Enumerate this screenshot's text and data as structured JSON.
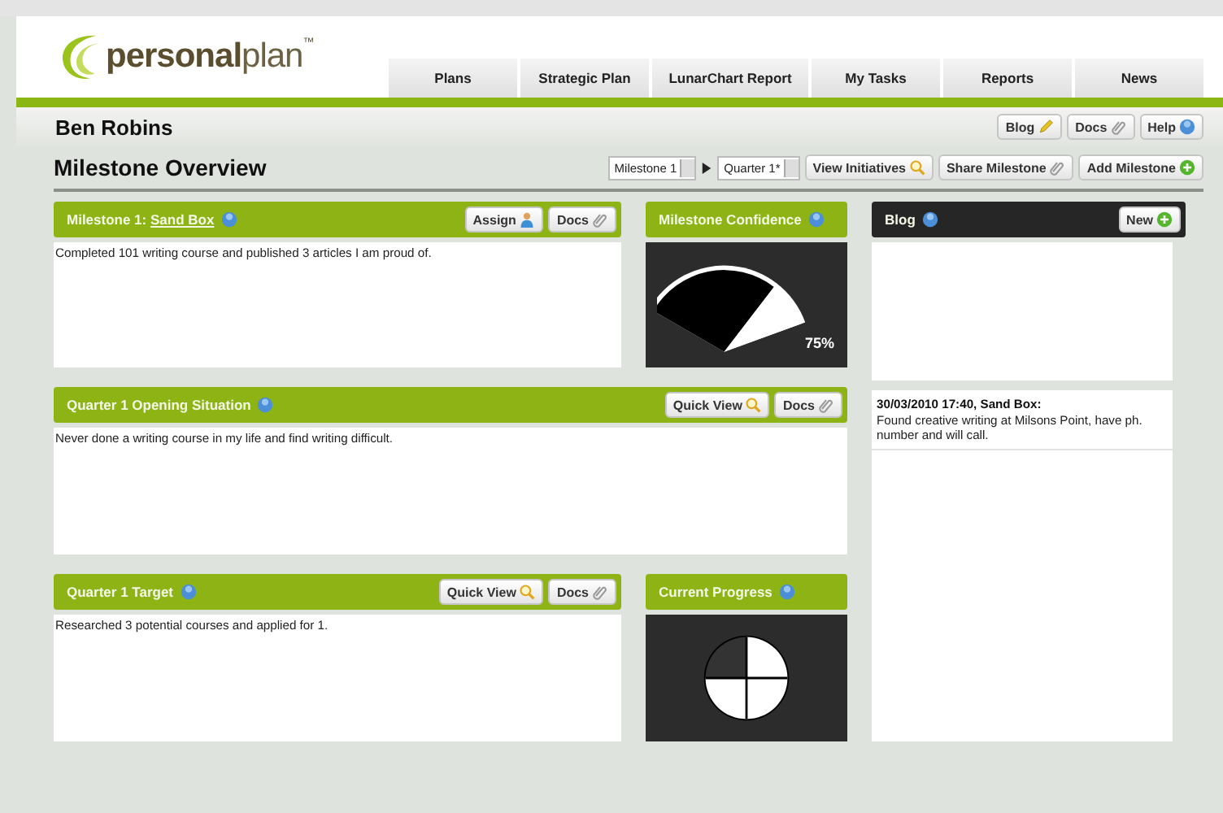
{
  "logo": {
    "bold": "personal",
    "light": "plan",
    "mark": "™"
  },
  "nav_tabs": [
    {
      "label": "Plans"
    },
    {
      "label": "Strategic Plan"
    },
    {
      "label": "LunarChart Report"
    },
    {
      "label": "My Tasks"
    },
    {
      "label": "Reports"
    },
    {
      "label": "News"
    }
  ],
  "user_name": "Ben Robins",
  "header_buttons": [
    {
      "label": "Blog",
      "kind": "pencil"
    },
    {
      "label": "Docs",
      "kind": "clip"
    },
    {
      "label": "Help",
      "kind": "info"
    }
  ],
  "page_title": "Milestone Overview",
  "selectors": [
    {
      "value": "Milestone 1"
    },
    {
      "value": "Quarter 1*"
    }
  ],
  "actions": [
    {
      "label": "View Initiatives",
      "kind": "search"
    },
    {
      "label": "Share Milestone",
      "kind": "clip"
    },
    {
      "label": "Add Milestone",
      "kind": "add"
    }
  ],
  "milestone": {
    "title": "Milestone 1: ",
    "link": "Sand Box",
    "buttons": [
      {
        "label": "Assign",
        "kind": "person"
      },
      {
        "label": "Docs",
        "kind": "clip"
      }
    ],
    "text": "Completed 101 writing course and published 3 articles I am proud of."
  },
  "confidence": {
    "title": "Milestone Confidence",
    "level": 0.75,
    "reading": "75%"
  },
  "blog": {
    "title": "Blog",
    "new_button": {
      "label": "New",
      "kind": "add"
    },
    "entries": [
      {
        "heading": "30/03/2010 17:40, Sand Box:",
        "text": "Found creative writing at Milsons Point, have ph. number and will call."
      }
    ]
  },
  "opening": {
    "title": "Quarter 1 Opening Situation",
    "buttons": [
      {
        "label": "Quick View",
        "kind": "search"
      },
      {
        "label": "Docs",
        "kind": "clip"
      }
    ],
    "text": "Never done a writing course in my life and find writing difficult."
  },
  "target": {
    "title": "Quarter 1 Target",
    "buttons": [
      {
        "label": "Quick View",
        "kind": "search"
      },
      {
        "label": "Docs",
        "kind": "clip"
      }
    ],
    "text": "Researched 3 potential courses and applied for 1."
  },
  "progress": {
    "title": "Current Progress",
    "level": 0.25
  }
}
